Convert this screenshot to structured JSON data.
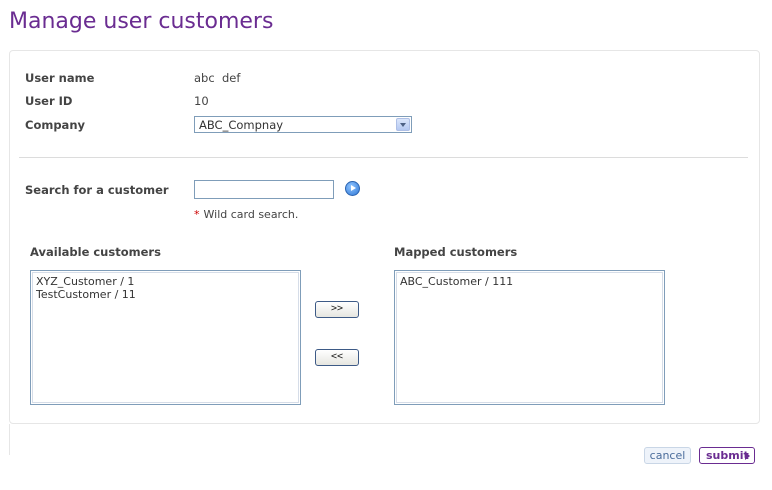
{
  "page": {
    "title": "Manage user customers"
  },
  "user": {
    "name_label": "User name",
    "name_value": "abc  def",
    "id_label": "User ID",
    "id_value": "10",
    "company_label": "Company",
    "company_value": "ABC_Compnay"
  },
  "search": {
    "label": "Search for a customer",
    "value": "",
    "hint_star": "*",
    "hint_text": "Wild card search.",
    "go_icon": "go-arrow-icon"
  },
  "available": {
    "label": "Available customers",
    "items": [
      "XYZ_Customer / 1",
      "TestCustomer / 11"
    ]
  },
  "mapped": {
    "label": "Mapped customers",
    "items": [
      "ABC_Customer / 111"
    ]
  },
  "buttons": {
    "add": ">>",
    "remove": "<<",
    "cancel": "cancel",
    "submit": "submit"
  },
  "colors": {
    "title": "#6a2c91",
    "required_star": "#cc0000",
    "cancel_text": "#4a6c9b"
  }
}
